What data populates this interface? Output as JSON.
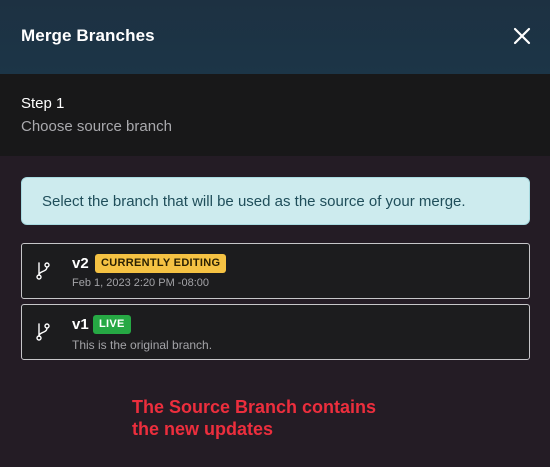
{
  "dialog": {
    "title": "Merge Branches",
    "close_icon": "close-icon"
  },
  "step": {
    "label": "Step 1",
    "description": "Choose source branch"
  },
  "info": {
    "text": "Select the branch that will be used as the source of your merge."
  },
  "branches": [
    {
      "name": "v2",
      "badge": "CURRENTLY EDITING",
      "badge_color": "#f5c243",
      "meta": "Feb 1, 2023 2:20 PM -08:00",
      "icon": "git-branch-icon"
    },
    {
      "name": "v1",
      "badge": "LIVE",
      "badge_color": "#26a844",
      "meta": "This is the original branch.",
      "icon": "git-branch-icon"
    }
  ],
  "annotation": {
    "line1": "The Source Branch contains",
    "line2": "the new updates",
    "color": "#ec2e3d"
  }
}
